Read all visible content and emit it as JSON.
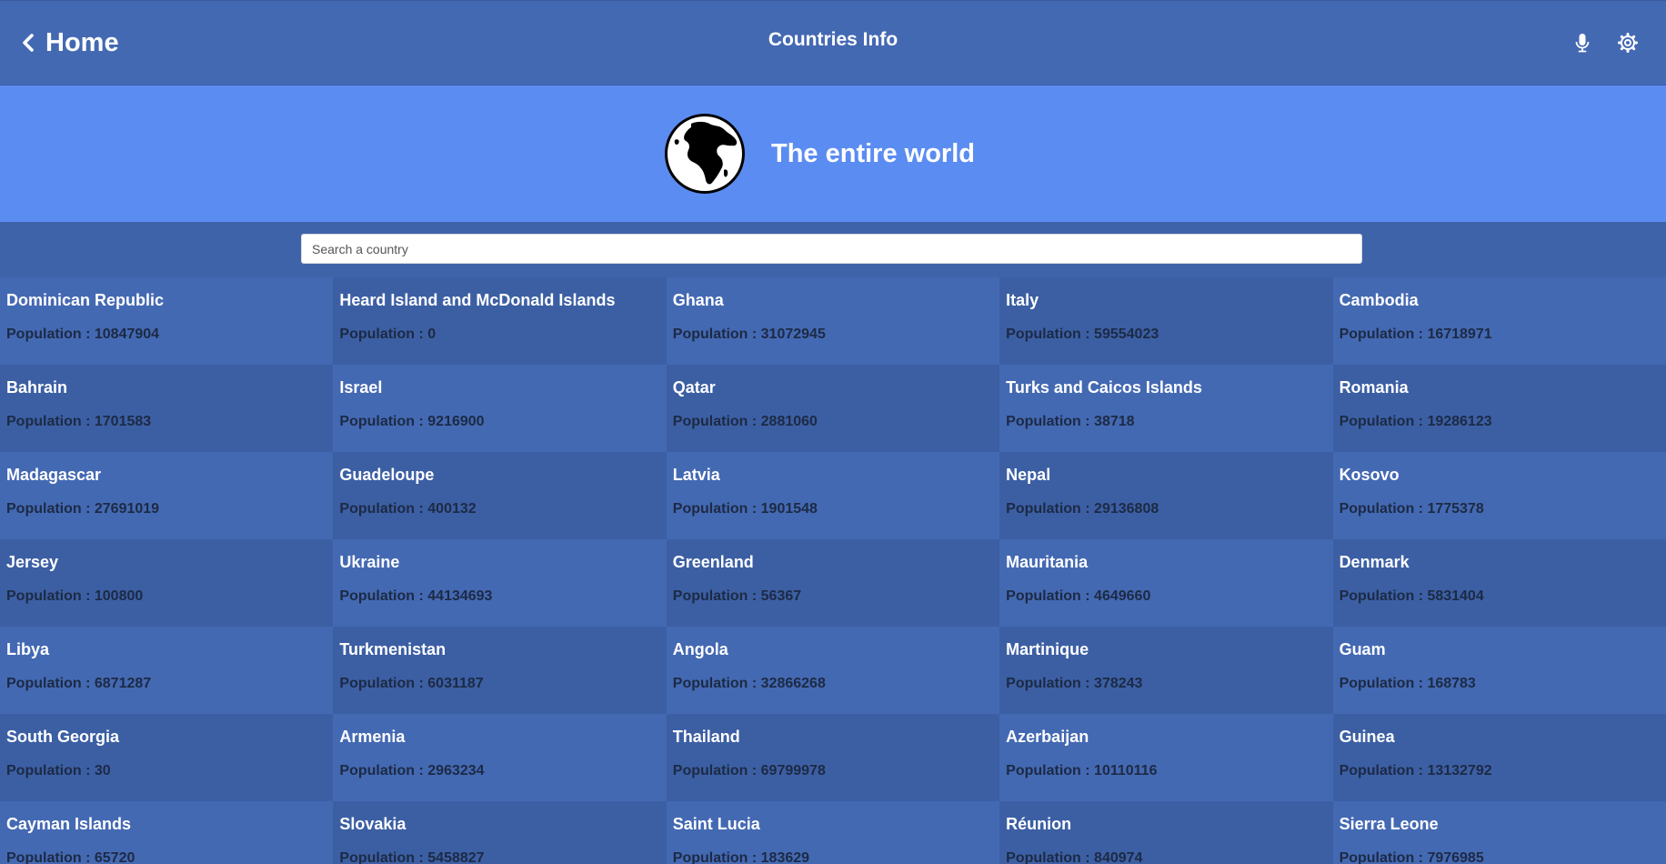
{
  "header": {
    "back_label": "Home",
    "title": "Countries Info",
    "icons": [
      "chevron-left-icon",
      "microphone-icon",
      "gear-icon"
    ]
  },
  "hero": {
    "title": "The entire world",
    "icon": "globe-icon"
  },
  "search": {
    "placeholder": "Search a country",
    "value": ""
  },
  "countries": [
    {
      "name": "Dominican Republic",
      "population": "Population : 10847904"
    },
    {
      "name": "Heard Island and McDonald Islands",
      "population": "Population : 0"
    },
    {
      "name": "Ghana",
      "population": "Population : 31072945"
    },
    {
      "name": "Italy",
      "population": "Population : 59554023"
    },
    {
      "name": "Cambodia",
      "population": "Population : 16718971"
    },
    {
      "name": "Bahrain",
      "population": "Population : 1701583"
    },
    {
      "name": "Israel",
      "population": "Population : 9216900"
    },
    {
      "name": "Qatar",
      "population": "Population : 2881060"
    },
    {
      "name": "Turks and Caicos Islands",
      "population": "Population : 38718"
    },
    {
      "name": "Romania",
      "population": "Population : 19286123"
    },
    {
      "name": "Madagascar",
      "population": "Population : 27691019"
    },
    {
      "name": "Guadeloupe",
      "population": "Population : 400132"
    },
    {
      "name": "Latvia",
      "population": "Population : 1901548"
    },
    {
      "name": "Nepal",
      "population": "Population : 29136808"
    },
    {
      "name": "Kosovo",
      "population": "Population : 1775378"
    },
    {
      "name": "Jersey",
      "population": "Population : 100800"
    },
    {
      "name": "Ukraine",
      "population": "Population : 44134693"
    },
    {
      "name": "Greenland",
      "population": "Population : 56367"
    },
    {
      "name": "Mauritania",
      "population": "Population : 4649660"
    },
    {
      "name": "Denmark",
      "population": "Population : 5831404"
    },
    {
      "name": "Libya",
      "population": "Population : 6871287"
    },
    {
      "name": "Turkmenistan",
      "population": "Population : 6031187"
    },
    {
      "name": "Angola",
      "population": "Population : 32866268"
    },
    {
      "name": "Martinique",
      "population": "Population : 378243"
    },
    {
      "name": "Guam",
      "population": "Population : 168783"
    },
    {
      "name": "South Georgia",
      "population": "Population : 30"
    },
    {
      "name": "Armenia",
      "population": "Population : 2963234"
    },
    {
      "name": "Thailand",
      "population": "Population : 69799978"
    },
    {
      "name": "Azerbaijan",
      "population": "Population : 10110116"
    },
    {
      "name": "Guinea",
      "population": "Population : 13132792"
    },
    {
      "name": "Cayman Islands",
      "population": "Population : 65720"
    },
    {
      "name": "Slovakia",
      "population": "Population : 5458827"
    },
    {
      "name": "Saint Lucia",
      "population": "Population : 183629"
    },
    {
      "name": "Réunion",
      "population": "Population : 840974"
    },
    {
      "name": "Sierra Leone",
      "population": "Population : 7976985"
    }
  ]
}
